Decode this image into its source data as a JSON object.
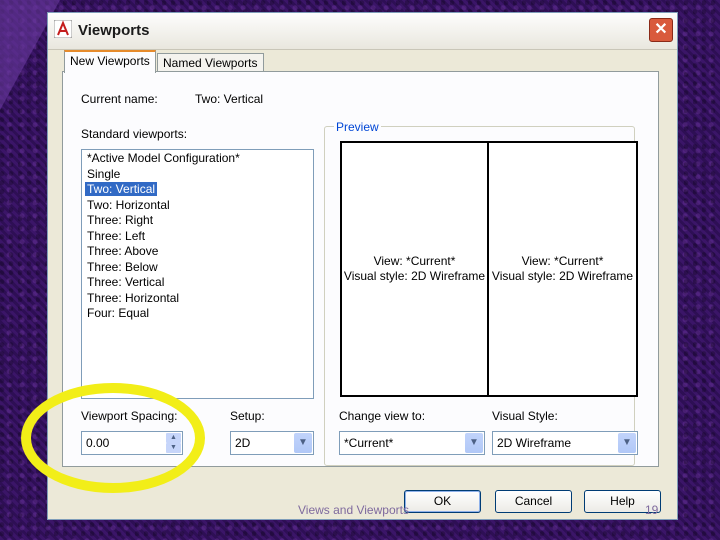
{
  "window": {
    "title": "Viewports",
    "close_glyph": "✕",
    "app_icon": "autocad-a-icon"
  },
  "tabs": [
    {
      "label": "New Viewports",
      "active": true
    },
    {
      "label": "Named Viewports",
      "active": false
    }
  ],
  "current_name": {
    "label": "Current name:",
    "value": "Two:  Vertical"
  },
  "standard_viewports": {
    "label": "Standard viewports:",
    "items": [
      "*Active Model Configuration*",
      "Single",
      "Two:  Vertical",
      "Two:  Horizontal",
      "Three: Right",
      "Three: Left",
      "Three: Above",
      "Three: Below",
      "Three: Vertical",
      "Three: Horizontal",
      "Four:  Equal"
    ],
    "selected_index": 2
  },
  "preview": {
    "label": "Preview",
    "left": {
      "view": "View: *Current*",
      "style": "Visual style: 2D Wireframe"
    },
    "right": {
      "view": "View: *Current*",
      "style": "Visual style: 2D Wireframe"
    }
  },
  "viewport_spacing": {
    "label": "Viewport Spacing:",
    "value": "0.00"
  },
  "setup": {
    "label": "Setup:",
    "value": "2D"
  },
  "change_view": {
    "label": "Change view to:",
    "value": "*Current*"
  },
  "visual_style": {
    "label": "Visual Style:",
    "value": "2D Wireframe"
  },
  "buttons": {
    "ok": "OK",
    "cancel": "Cancel",
    "help": "Help"
  },
  "footer": {
    "text": "Views and Viewports",
    "slide_number": "19"
  },
  "colors": {
    "highlight": "#f2ee18",
    "selection": "#316ac5",
    "background": "#3a1466"
  }
}
